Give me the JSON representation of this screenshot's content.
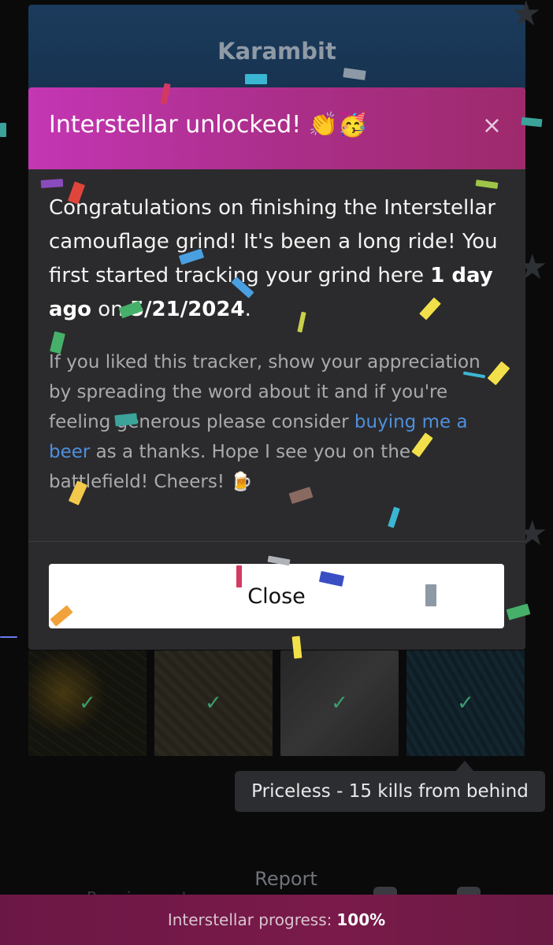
{
  "background": {
    "card_title": "Karambit",
    "tooltip": "Priceless - 15 kills from behind",
    "report_label": "Report",
    "nav_partial_label": "Requirements",
    "progress": {
      "label": "Interstellar progress:",
      "value": "100%"
    }
  },
  "modal": {
    "title": "Interstellar unlocked! 👏🥳",
    "close_icon": "×",
    "body": {
      "p1_a": "Congratulations on finishing the Interstellar camouflage grind! It's been a long ride! You first started tracking your grind here ",
      "p1_time": "1 day ago",
      "p1_b": " on ",
      "p1_date": "5/21/2024",
      "p1_c": ".",
      "p2_a": "If you liked this tracker, show your appreciation by spreading the word about it and if you're feeling generous please consider ",
      "p2_link": "buying me a beer",
      "p2_b": " as a thanks. Hope I see you on the battlefield! Cheers! 🍺"
    },
    "close_button": "Close"
  },
  "tiles": [
    "check-icon",
    "check-icon",
    "check-icon",
    "check-icon"
  ],
  "colors": {
    "header_gradient_start": "#c436b4",
    "header_gradient_end": "#9e2a6c",
    "modal_bg": "#2b2b2d",
    "link": "#4f8fde",
    "check": "#3d9c6e",
    "progress_bar": "#7a1a4a"
  }
}
